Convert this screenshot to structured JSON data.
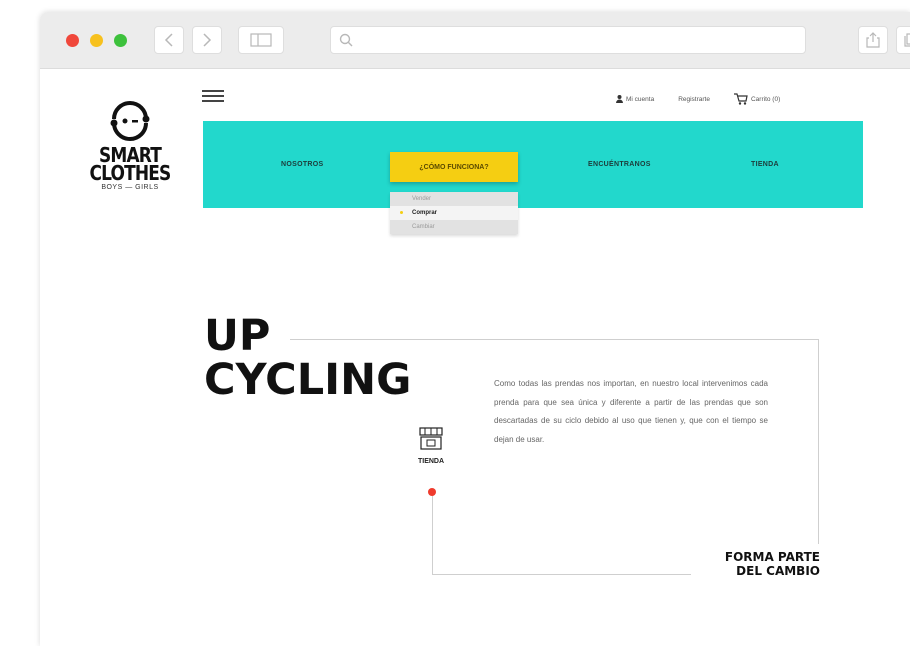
{
  "brand": {
    "title_line1": "SMART",
    "title_line2": "CLOTHES",
    "subtitle": "BOYS — GIRLS"
  },
  "top_links": {
    "account": "Mi cuenta",
    "register": "Registrarte",
    "cart": "Carrito (0)"
  },
  "nav": {
    "items": [
      "NOSOTROS",
      "¿CÓMO FUNCIONA?",
      "ENCUÉNTRANOS",
      "TIENDA"
    ],
    "active_index": 1,
    "dropdown": [
      "Vender",
      "Comprar",
      "Cambiar"
    ],
    "dropdown_selected": 1
  },
  "hero": {
    "title_line1": "UP",
    "title_line2": "CYCLING",
    "shop_label": "TIENDA",
    "paragraph": "Como todas las prendas nos importan, en nuestro local intervenimos cada prenda para que sea única y diferente a partir de las prendas que son descartadas de su ciclo debido al uso que tienen y, que con el tiempo se dejan de usar.",
    "cta_line1": "FORMA PARTE",
    "cta_line2": "DEL CAMBIO"
  },
  "colors": {
    "nav_band": "#22d8cc",
    "active_tab": "#f5ce12",
    "accent_dot": "#ef3b2d",
    "close_dot": "#f0473b",
    "minimize_dot": "#f7c11e",
    "zoom_dot": "#3dc13c"
  },
  "icons": [
    "back-arrow-icon",
    "forward-arrow-icon",
    "sidebar-icon",
    "search-icon",
    "share-icon",
    "tabs-icon",
    "user-icon",
    "cart-icon",
    "hamburger-menu-icon",
    "storefront-icon"
  ]
}
